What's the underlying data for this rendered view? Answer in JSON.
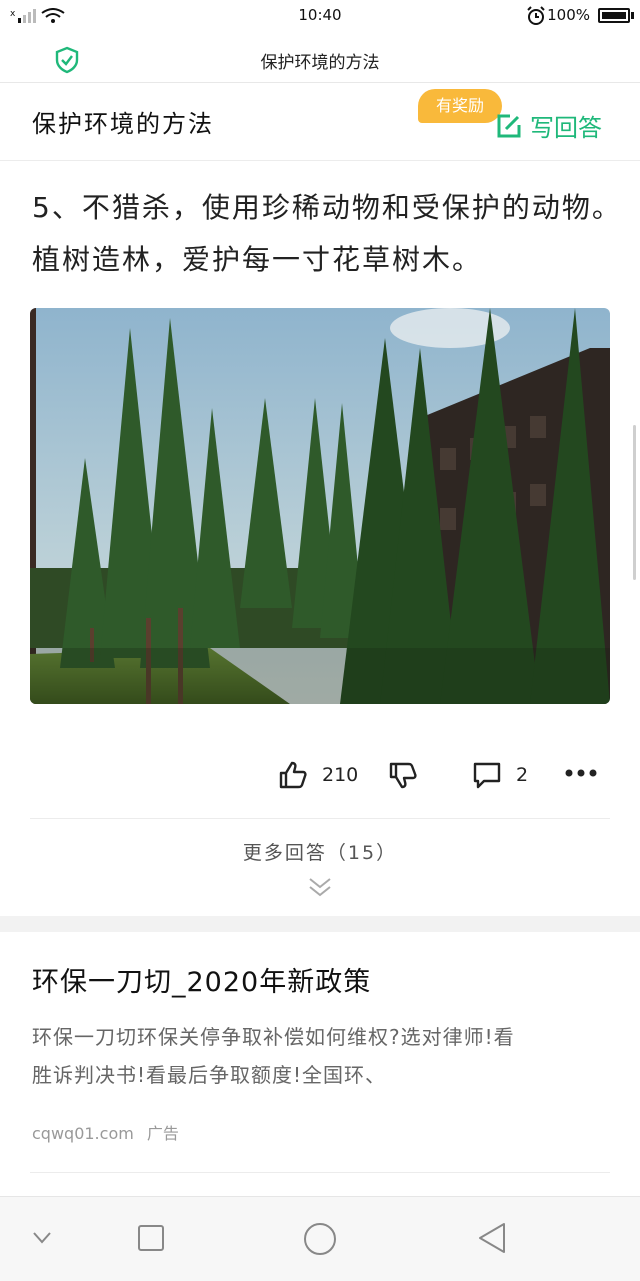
{
  "status_bar": {
    "time": "10:40",
    "battery": "100%"
  },
  "titlebar": {
    "title": "保护环境的方法"
  },
  "question": {
    "title": "保护环境的方法",
    "reward_badge": "有奖励",
    "write_answer": "写回答"
  },
  "answer": {
    "text_line1": "5、不猎杀，使用珍稀动物和受保护的动物。",
    "text_line2": "植树造林，爱护每一寸花草树木。",
    "likes": "210",
    "comments": "2"
  },
  "more_answers": "更多回答（15）",
  "ad": {
    "title": "环保一刀切_2020年新政策",
    "desc_line1": "环保一刀切环保关停争取补偿如何维权?选对律师!看",
    "desc_line2": "胜诉判决书!看最后争取额度!全国环、",
    "source": "cqwq01.com",
    "label": "广告"
  },
  "colors": {
    "accent_green": "#1fb87a",
    "reward_orange": "#f9b93b"
  }
}
